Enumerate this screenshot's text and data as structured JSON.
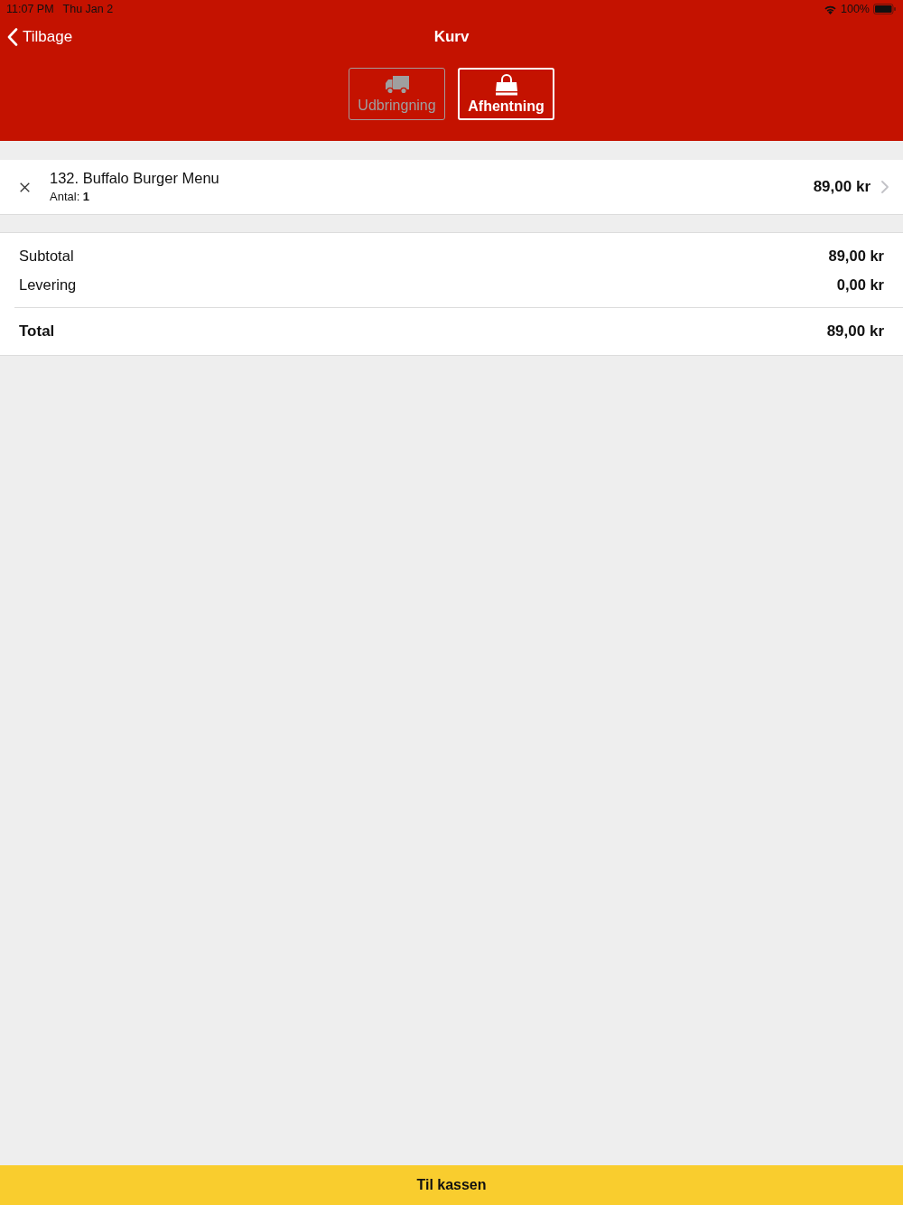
{
  "status_bar": {
    "time": "11:07 PM",
    "date": "Thu Jan 2",
    "battery": "100%"
  },
  "nav_bar": {
    "back": "Tilbage",
    "title": "Kurv"
  },
  "delivery_modes": [
    {
      "kind": "delivery",
      "label": "Udbringning",
      "selected": false
    },
    {
      "kind": "pickup",
      "label": "Afhentning",
      "selected": true
    }
  ],
  "cart_items": [
    {
      "name": "132. Buffalo Burger Menu",
      "quantity": "Antal: **1**",
      "price": "89,00 kr"
    }
  ],
  "summary": {
    "rows": [
      {
        "label": "Subtotal",
        "value": "89,00 kr"
      },
      {
        "label": "Levering",
        "value": "0,00 kr"
      }
    ],
    "total": {
      "label": "Total",
      "value": "89,00 kr"
    }
  },
  "checkout_button": "Til kassen"
}
